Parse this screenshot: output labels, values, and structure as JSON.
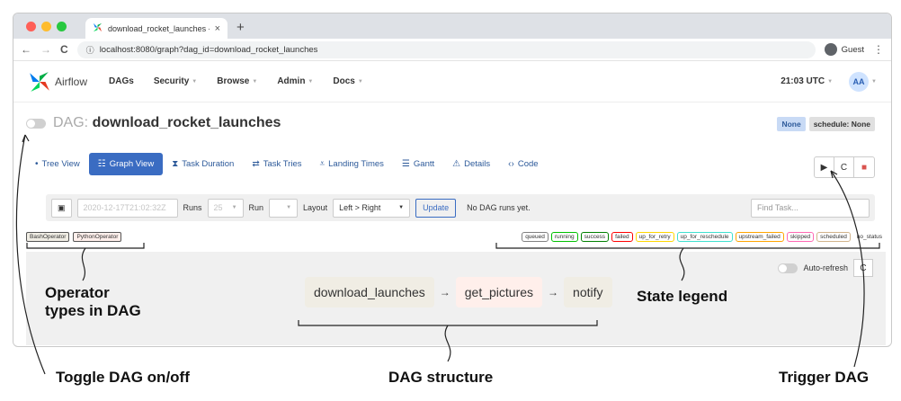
{
  "browser": {
    "tab_title": "download_rocket_launches - з",
    "tab_close": "×",
    "new_tab": "+",
    "nav_back": "←",
    "nav_forward": "→",
    "nav_reload": "C",
    "url": "localhost:8080/graph?dag_id=download_rocket_launches",
    "guest_label": "Guest",
    "menu": "⋮",
    "traffic_colors": [
      "#ff5f57",
      "#febc2e",
      "#28c840"
    ]
  },
  "navbar": {
    "brand": "Airflow",
    "items": [
      "DAGs",
      "Security",
      "Browse",
      "Admin",
      "Docs"
    ],
    "time": "21:03 UTC",
    "avatar": "AA"
  },
  "dag": {
    "prefix": "DAG:",
    "name": "download_rocket_launches",
    "badge_none": "None",
    "badge_schedule": "schedule: None"
  },
  "views": [
    {
      "label": "Tree View",
      "icon": "•"
    },
    {
      "label": "Graph View",
      "icon": "☷",
      "active": true
    },
    {
      "label": "Task Duration",
      "icon": "⧗"
    },
    {
      "label": "Task Tries",
      "icon": "⇄"
    },
    {
      "label": "Landing Times",
      "icon": "⩡"
    },
    {
      "label": "Gantt",
      "icon": "☰"
    },
    {
      "label": "Details",
      "icon": "⚠"
    },
    {
      "label": "Code",
      "icon": "‹›"
    }
  ],
  "actions": {
    "trigger": "▶",
    "refresh": "C",
    "delete": "■"
  },
  "filters": {
    "calendar_icon": "▣",
    "date_value": "2020-12-17T21:02:32Z",
    "runs_label": "Runs",
    "runs_value": "25",
    "run_label": "Run",
    "layout_label": "Layout",
    "layout_value": "Left > Right",
    "update_label": "Update",
    "no_runs_text": "No DAG runs yet.",
    "find_task_placeholder": "Find Task..."
  },
  "operators": [
    "BashOperator",
    "PythonOperator"
  ],
  "states": [
    {
      "label": "queued",
      "color": "#808080"
    },
    {
      "label": "running",
      "color": "#00c000"
    },
    {
      "label": "success",
      "color": "#008000"
    },
    {
      "label": "failed",
      "color": "#ff0000"
    },
    {
      "label": "up_for_retry",
      "color": "#ffd700"
    },
    {
      "label": "up_for_reschedule",
      "color": "#40e0d0"
    },
    {
      "label": "upstream_failed",
      "color": "#ffa500"
    },
    {
      "label": "skipped",
      "color": "#ff69b4"
    },
    {
      "label": "scheduled",
      "color": "#d2b48c"
    },
    {
      "label": "no_status",
      "color": "#ffffff"
    }
  ],
  "graph": {
    "auto_refresh_label": "Auto-refresh",
    "refresh_icon": "C",
    "tasks": [
      {
        "label": "download_launches",
        "color": "#f0ede4"
      },
      {
        "label": "get_pictures",
        "color": "#ffefeb"
      },
      {
        "label": "notify",
        "color": "#f0ede4"
      }
    ],
    "arrow": "→"
  },
  "annotations": {
    "operator_types": "Operator\ntypes in DAG",
    "state_legend": "State legend",
    "toggle_dag": "Toggle DAG on/off",
    "dag_structure": "DAG structure",
    "trigger_dag": "Trigger DAG"
  }
}
